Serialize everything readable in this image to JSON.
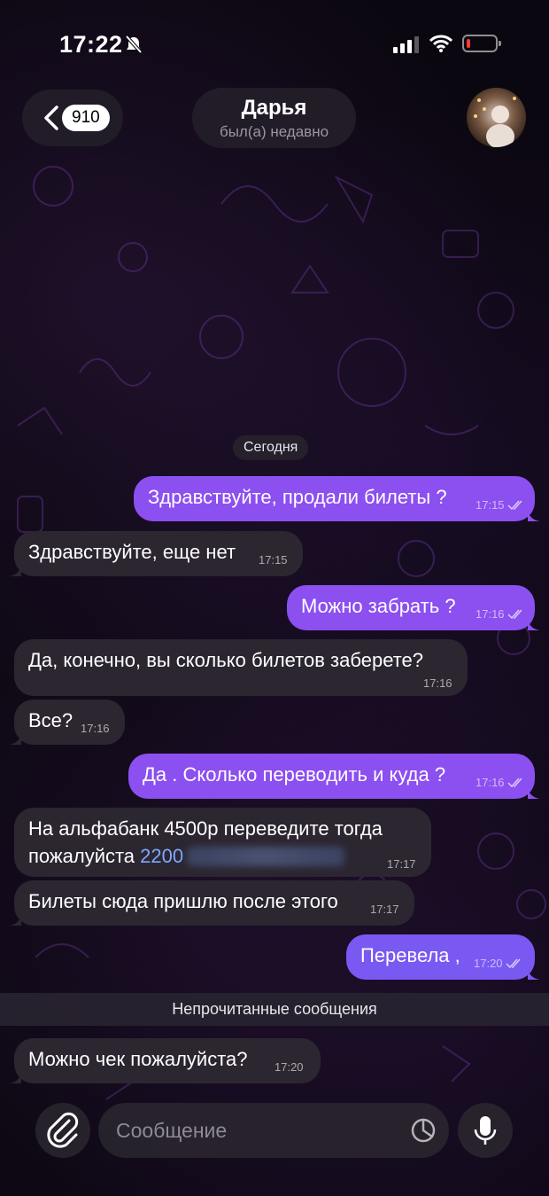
{
  "status_bar": {
    "time": "17:22",
    "battery_level": 0.12
  },
  "header": {
    "back_count": "910",
    "contact_name": "Дарья",
    "contact_status": "был(а) недавно"
  },
  "date_separator": "Сегодня",
  "messages": [
    {
      "text": "Здравствуйте, продали билеты ?",
      "time": "17:15"
    },
    {
      "text": "Здравствуйте, еще нет",
      "time": "17:15"
    },
    {
      "text": "Можно забрать ?",
      "time": "17:16"
    },
    {
      "text": "Да, конечно, вы сколько билетов заберете?",
      "time": "17:16"
    },
    {
      "text": "Все?",
      "time": "17:16"
    },
    {
      "text": "Да . Сколько переводить и куда ?",
      "time": "17:16"
    },
    {
      "line1": "На альфабанк 4500р переведите тогда",
      "line2": "пожалуйста ",
      "link": "2200",
      "time": "17:17"
    },
    {
      "text": "Билеты сюда пришлю после этого",
      "time": "17:17"
    },
    {
      "text": "Перевела ,",
      "time": "17:20"
    },
    {
      "text": "Можно чек пожалуйста?",
      "time": "17:20"
    }
  ],
  "unread_separator": "Непрочитанные сообщения",
  "composer": {
    "placeholder": "Сообщение"
  },
  "colors": {
    "outgoing": "#8c4ff0",
    "incoming": "#2c2631",
    "accent": "#7a58f2"
  }
}
